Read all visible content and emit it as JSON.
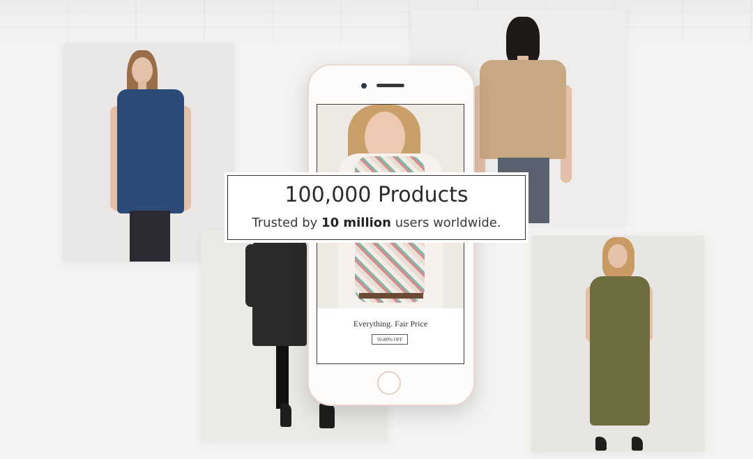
{
  "hero": {
    "headline": "100,000 Products",
    "subline_prefix": "Trusted by ",
    "subline_emphasis": "10 million",
    "subline_suffix": " users worldwide."
  },
  "phone_screen": {
    "tagline": "Everything. Fair Price",
    "discount_badge": "50-80% OFF"
  },
  "colors": {
    "background": "#f4f3f1",
    "navy_top": "#2b4a78",
    "tan_tee": "#c9a884",
    "olive_dress": "#6f6c3e",
    "polka_dress": "#2a2a2a",
    "phone_frame": "#ead8cf"
  }
}
